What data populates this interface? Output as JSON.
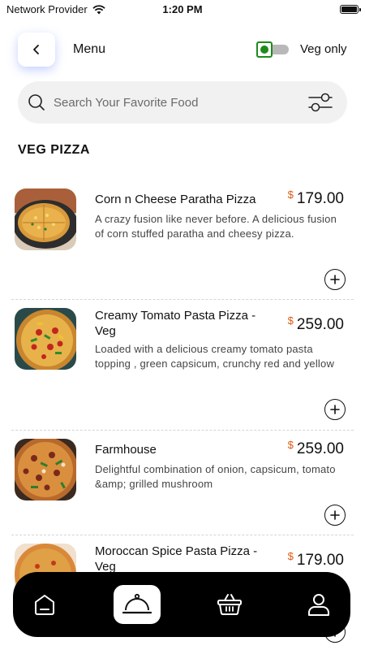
{
  "status_bar": {
    "carrier": "Network Provider",
    "time": "1:20 PM"
  },
  "header": {
    "title": "Menu",
    "veg_only_label": "Veg only",
    "veg_only_on": true
  },
  "search": {
    "placeholder": "Search Your Favorite Food"
  },
  "section": {
    "title": "VEG PIZZA"
  },
  "currency": "$",
  "items": [
    {
      "name": "Corn n Cheese Paratha Pizza",
      "price": "179.00",
      "description": "A crazy fusion like never before. A delicious fusion of corn stuffed paratha and cheesy pizza."
    },
    {
      "name": "Creamy Tomato Pasta Pizza - Veg",
      "price": "259.00",
      "description": "Loaded with a delicious creamy tomato pasta topping , green capsicum, crunchy red and yellow"
    },
    {
      "name": "Farmhouse",
      "price": "259.00",
      "description": "Delightful combination of onion, capsicum, tomato &amp; grilled mushroom"
    },
    {
      "name": "Moroccan Spice Pasta Pizza - Veg",
      "price": "179.00",
      "description": ""
    }
  ],
  "nav": {
    "items": [
      "home-icon",
      "cloche-icon",
      "basket-icon",
      "profile-icon"
    ],
    "active": "cloche-icon"
  },
  "colors": {
    "accent_orange": "#e05a14",
    "veg_green": "#1e8a1e",
    "nav_bg": "#000000",
    "search_bg": "#f1f1f1"
  }
}
